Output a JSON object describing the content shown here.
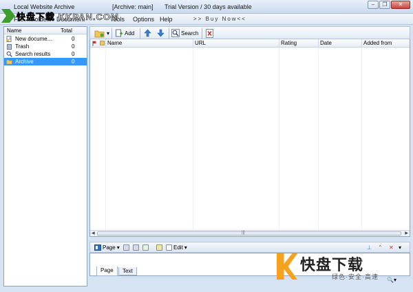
{
  "title_bar": {
    "app_name": "Local Website Archive",
    "archive": "[Archive: main]",
    "trial": "Trial Version / 30 days available"
  },
  "watermark": {
    "text": "快盘下载 KKPAN.COM"
  },
  "menu": {
    "items": [
      "File",
      "Folder",
      "Document",
      "Tools",
      "Options",
      "Help"
    ],
    "buy_now": ">> Buy  Now<<"
  },
  "left_panel": {
    "header": {
      "name": "Name",
      "total": "Total"
    },
    "items": [
      {
        "label": "New docume...",
        "count": "0",
        "icon": "new-document-icon"
      },
      {
        "label": "Trash",
        "count": "0",
        "icon": "trash-icon"
      },
      {
        "label": "Search results",
        "count": "0",
        "icon": "search-icon"
      },
      {
        "label": "Archive",
        "count": "0",
        "icon": "folder-icon",
        "selected": true
      }
    ]
  },
  "toolbar": {
    "add_label": "Add",
    "search_label": "Search"
  },
  "grid": {
    "columns": [
      "Name",
      "URL",
      "Rating",
      "Date",
      "Added from"
    ],
    "rows": []
  },
  "preview_toolbar": {
    "page_label": "Page",
    "edit_label": "Edit"
  },
  "tabs": [
    "Page",
    "Text"
  ],
  "promo": {
    "title": "快盘下载",
    "tagline": "绿色·安全·高速"
  },
  "colors": {
    "selection": "#3399ff",
    "accent_green": "#3aa02b",
    "accent_orange": "#f6a21e"
  }
}
